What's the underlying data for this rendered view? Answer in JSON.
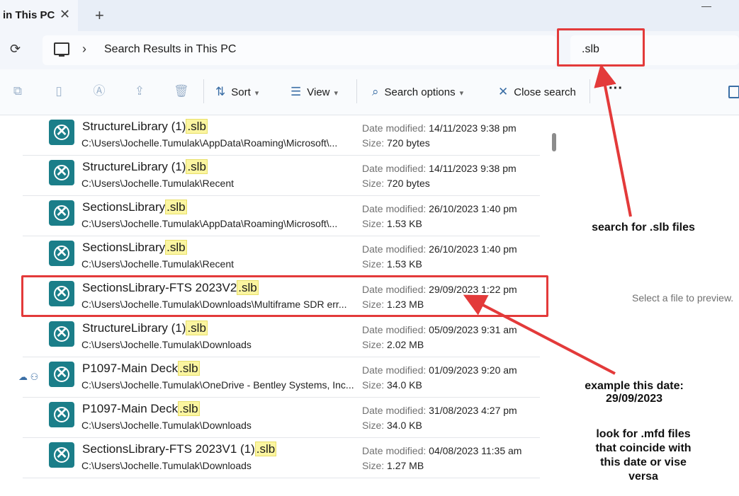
{
  "tab": {
    "title": "in This PC",
    "close_label": "✕",
    "new_tab_label": "+"
  },
  "window": {
    "minimize_label": "—"
  },
  "address": {
    "breadcrumb": "Search Results in This PC",
    "search_value": ".slb"
  },
  "toolbar": {
    "sort_label": "Sort",
    "view_label": "View",
    "search_options_label": "Search options",
    "close_search_label": "Close search",
    "more_label": "···"
  },
  "labels": {
    "date_modified": "Date modified:",
    "size": "Size:"
  },
  "files": [
    {
      "base": "StructureLibrary (1)",
      "ext": ".slb",
      "path": "C:\\Users\\Jochelle.Tumulak\\AppData\\Roaming\\Microsoft\\...",
      "date": "14/11/2023 9:38 pm",
      "size": "720 bytes"
    },
    {
      "base": "StructureLibrary (1)",
      "ext": ".slb",
      "path": "C:\\Users\\Jochelle.Tumulak\\Recent",
      "date": "14/11/2023 9:38 pm",
      "size": "720 bytes"
    },
    {
      "base": "SectionsLibrary",
      "ext": ".slb",
      "path": "C:\\Users\\Jochelle.Tumulak\\AppData\\Roaming\\Microsoft\\...",
      "date": "26/10/2023 1:40 pm",
      "size": "1.53 KB"
    },
    {
      "base": "SectionsLibrary",
      "ext": ".slb",
      "path": "C:\\Users\\Jochelle.Tumulak\\Recent",
      "date": "26/10/2023 1:40 pm",
      "size": "1.53 KB"
    },
    {
      "base": "SectionsLibrary-FTS 2023V2",
      "ext": ".slb",
      "path": "C:\\Users\\Jochelle.Tumulak\\Downloads\\Multiframe SDR err...",
      "date": "29/09/2023 1:22 pm",
      "size": "1.23 MB"
    },
    {
      "base": "StructureLibrary (1)",
      "ext": ".slb",
      "path": "C:\\Users\\Jochelle.Tumulak\\Downloads",
      "date": "05/09/2023 9:31 am",
      "size": "2.02 MB"
    },
    {
      "base": "P1097-Main Deck",
      "ext": ".slb",
      "path": "C:\\Users\\Jochelle.Tumulak\\OneDrive - Bentley Systems, Inc...",
      "date": "01/09/2023 9:20 am",
      "size": "34.0 KB"
    },
    {
      "base": "P1097-Main Deck",
      "ext": ".slb",
      "path": "C:\\Users\\Jochelle.Tumulak\\Downloads",
      "date": "31/08/2023 4:27 pm",
      "size": "34.0 KB"
    },
    {
      "base": "SectionsLibrary-FTS 2023V1 (1)",
      "ext": ".slb",
      "path": "C:\\Users\\Jochelle.Tumulak\\Downloads",
      "date": "04/08/2023 11:35 am",
      "size": "1.27 MB"
    }
  ],
  "preview": {
    "empty_text": "Select a file to preview."
  },
  "annotations": {
    "search_note": "search for .slb files",
    "date_note_line1": "example this date:",
    "date_note_line2": "29/09/2023",
    "look_line1": "look for .mfd files",
    "look_line2": "that coincide with",
    "look_line3": "this date or vise",
    "look_line4": "versa",
    "color": "#e33a3a"
  }
}
